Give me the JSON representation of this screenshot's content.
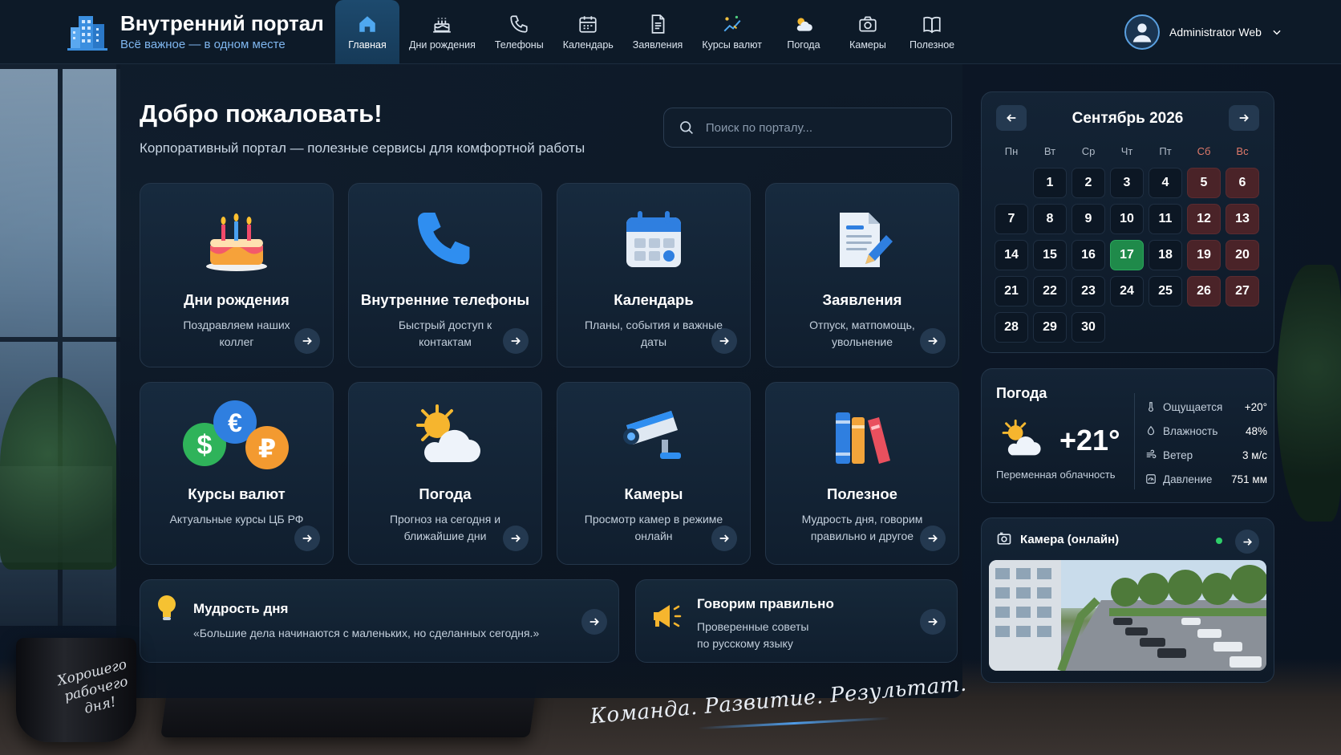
{
  "brand": {
    "title": "Внутренний портал",
    "subtitle": "Всё важное — в одном месте"
  },
  "nav": [
    {
      "label": "Главная",
      "icon": "home-icon",
      "active": true
    },
    {
      "label": "Дни рождения",
      "icon": "cake-icon"
    },
    {
      "label": "Телефоны",
      "icon": "phone-icon"
    },
    {
      "label": "Календарь",
      "icon": "calendar-icon"
    },
    {
      "label": "Заявления",
      "icon": "document-icon"
    },
    {
      "label": "Курсы валют",
      "icon": "currency-chart-icon"
    },
    {
      "label": "Погода",
      "icon": "weather-icon"
    },
    {
      "label": "Камеры",
      "icon": "camera-icon"
    },
    {
      "label": "Полезное",
      "icon": "book-icon"
    }
  ],
  "user": {
    "name": "Administrator Web"
  },
  "welcome": {
    "title": "Добро пожаловать!",
    "subtitle": "Корпоративный портал — полезные сервисы для комфортной работы"
  },
  "search": {
    "placeholder": "Поиск по порталу..."
  },
  "cards": [
    {
      "title": "Дни рождения",
      "desc": "Поздравляем наших коллег",
      "icon": "birthday-cake-icon"
    },
    {
      "title": "Внутренние телефоны",
      "desc": "Быстрый доступ к контактам",
      "icon": "phone-handset-icon"
    },
    {
      "title": "Календарь",
      "desc": "Планы, события и важные даты",
      "icon": "calendar-icon"
    },
    {
      "title": "Заявления",
      "desc": "Отпуск, матпомощь, увольнение",
      "icon": "document-pen-icon"
    },
    {
      "title": "Курсы валют",
      "desc": "Актуальные курсы ЦБ РФ",
      "icon": "currency-coins-icon"
    },
    {
      "title": "Погода",
      "desc": "Прогноз на сегодня и ближайшие дни",
      "icon": "sun-cloud-icon"
    },
    {
      "title": "Камеры",
      "desc": "Просмотр камер в режиме онлайн",
      "icon": "security-camera-icon"
    },
    {
      "title": "Полезное",
      "desc": "Мудрость дня, говорим правильно и другое",
      "icon": "books-icon"
    }
  ],
  "wisdom": {
    "title": "Мудрость дня",
    "text": "«Большие дела начинаются с маленьких, но сделанных сегодня.»"
  },
  "speak": {
    "title": "Говорим правильно",
    "text": "Проверенные советы по русскому языку"
  },
  "calendar": {
    "title": "Сентябрь 2026",
    "weekdays": [
      "Пн",
      "Вт",
      "Ср",
      "Чт",
      "Пт",
      "Сб",
      "Вс"
    ],
    "first_weekday_offset": 1,
    "days_in_month": 30,
    "today": 17
  },
  "weather": {
    "title": "Погода",
    "temp": "+21°",
    "desc": "Переменная облачность",
    "rows": [
      {
        "label": "Ощущается",
        "value": "+20°",
        "icon": "thermometer-icon"
      },
      {
        "label": "Влажность",
        "value": "48%",
        "icon": "droplet-icon"
      },
      {
        "label": "Ветер",
        "value": "3 м/с",
        "icon": "wind-icon"
      },
      {
        "label": "Давление",
        "value": "751 мм",
        "icon": "pressure-gauge-icon"
      }
    ]
  },
  "camera": {
    "title": "Камера (онлайн)"
  },
  "decor": {
    "mug_text": "Хорошего рабочего дня!",
    "slogan": "Команда. Развитие. Результат."
  },
  "colors": {
    "accent": "#4f9ce8",
    "today": "#1f8a4a",
    "weekend": "#4a2328"
  }
}
